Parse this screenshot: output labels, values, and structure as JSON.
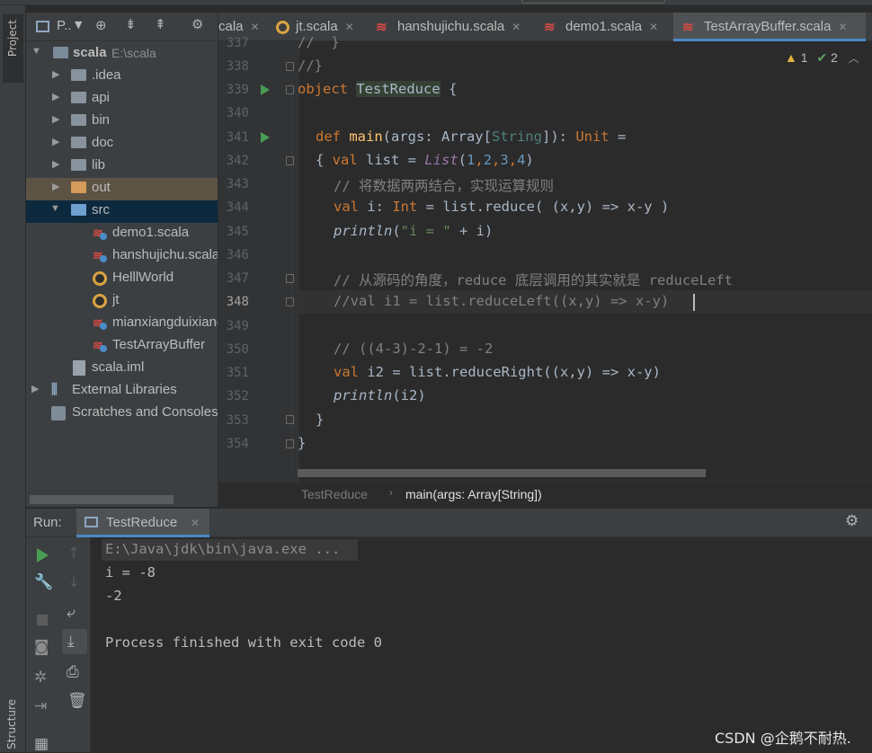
{
  "window": {
    "run_config": "TestReduce"
  },
  "left_toolbar": {
    "project_tab": "Project",
    "structure_tab": "Structure"
  },
  "project_panel": {
    "selector_label": "P..",
    "tree": [
      {
        "label": "scala",
        "path": "E:\\scala",
        "type": "project"
      },
      {
        "label": ".idea",
        "type": "folder"
      },
      {
        "label": "api",
        "type": "folder"
      },
      {
        "label": "bin",
        "type": "folder"
      },
      {
        "label": "doc",
        "type": "folder"
      },
      {
        "label": "lib",
        "type": "folder"
      },
      {
        "label": "out",
        "type": "folder-excluded"
      },
      {
        "label": "src",
        "type": "folder-source"
      },
      {
        "label": "demo1.scala",
        "type": "scala-file"
      },
      {
        "label": "hanshujichu.scala",
        "type": "scala-file"
      },
      {
        "label": "HelllWorld",
        "type": "object"
      },
      {
        "label": "jt",
        "type": "object"
      },
      {
        "label": "mianxiangduixiang",
        "type": "scala-file"
      },
      {
        "label": "TestArrayBuffer",
        "type": "scala-class"
      },
      {
        "label": "scala.iml",
        "type": "iml-file"
      },
      {
        "label": "External Libraries",
        "type": "libraries"
      },
      {
        "label": "Scratches and Consoles",
        "type": "scratches"
      }
    ]
  },
  "editor": {
    "tabs": [
      {
        "label": "cala",
        "active": false
      },
      {
        "label": "jt.scala",
        "active": false
      },
      {
        "label": "hanshujichu.scala",
        "active": false
      },
      {
        "label": "demo1.scala",
        "active": false
      },
      {
        "label": "TestArrayBuffer.scala",
        "active": true
      }
    ],
    "inspections": {
      "warnings": "1",
      "weak_warnings": "2"
    },
    "line_numbers": [
      "337",
      "338",
      "339",
      "340",
      "341",
      "342",
      "343",
      "344",
      "345",
      "346",
      "347",
      "348",
      "349",
      "350",
      "351",
      "352",
      "353",
      "354"
    ],
    "current_line": "348",
    "code": {
      "l337": "//  }",
      "l338": "//}",
      "l339_kw": "object ",
      "l339_name": "TestReduce",
      "l339_rest": " {",
      "l341_kw": "def ",
      "l341_name": "main",
      "l341_a": "(args: Array[",
      "l341_type": "String",
      "l341_b": "]): ",
      "l341_unit": "Unit",
      "l341_c": " =",
      "l342_a": "{ ",
      "l342_kw": "val",
      "l342_b": " list = ",
      "l342_list": "List",
      "l342_c": "(",
      "l342_n1": "1",
      "l342_n2": "2",
      "l342_n3": "3",
      "l342_n4": "4",
      "l342_d": ")",
      "l343": "// 将数据两两结合，实现运算规则",
      "l344_kw": "val",
      "l344_a": " i: ",
      "l344_type": "Int",
      "l344_b": " = list.reduce( (x,y) => x-y )",
      "l345_fn": "println",
      "l345_a": "(",
      "l345_str": "\"i = \"",
      "l345_b": " + i)",
      "l347": "// 从源码的角度，reduce 底层调用的其实就是 reduceLeft",
      "l348": "//val i1 = list.reduceLeft((x,y) => x-y)",
      "l350": "// ((4-3)-2-1) = -2",
      "l351_kw": "val",
      "l351_a": " i2 = list.reduceRight((x,y) => x-y)",
      "l352_fn": "println",
      "l352_a": "(i2)",
      "l353": "}",
      "l354": "}"
    },
    "breadcrumb": {
      "object": "TestReduce",
      "method": "main(args: Array[String])"
    }
  },
  "run_panel": {
    "label": "Run:",
    "tab": "TestReduce",
    "console": [
      "E:\\Java\\jdk\\bin\\java.exe ...",
      "i = -8",
      "-2",
      "",
      "Process finished with exit code 0"
    ]
  },
  "watermark": "CSDN @企鹅不耐热."
}
